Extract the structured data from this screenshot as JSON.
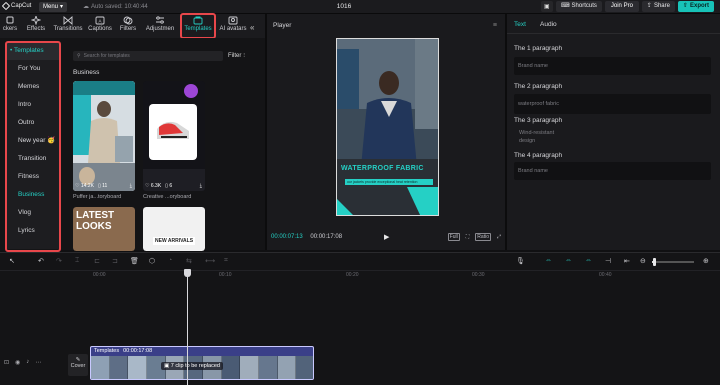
{
  "topbar": {
    "logo": "CapCut",
    "menu_label": "Menu",
    "autosave": "Auto saved: 10:40:44",
    "project_title": "1016",
    "shortcuts_label": "Shortcuts",
    "join_pro_label": "Join Pro",
    "share_label": "Share",
    "export_label": "Export"
  },
  "tool_tabs": [
    {
      "label": "ckers",
      "icon": "sticker-icon"
    },
    {
      "label": "Effects",
      "icon": "effects-icon"
    },
    {
      "label": "Transitions",
      "icon": "transitions-icon"
    },
    {
      "label": "Captions",
      "icon": "captions-icon"
    },
    {
      "label": "Filters",
      "icon": "filters-icon"
    },
    {
      "label": "Adjustmen",
      "icon": "adjustment-icon"
    },
    {
      "label": "Templates",
      "icon": "templates-icon"
    },
    {
      "label": "AI avatars",
      "icon": "ai-avatar-icon"
    }
  ],
  "categories": [
    {
      "label": "• Templates"
    },
    {
      "label": "For You"
    },
    {
      "label": "Memes"
    },
    {
      "label": "Intro"
    },
    {
      "label": "Outro"
    },
    {
      "label": "New year 🥳"
    },
    {
      "label": "Transition"
    },
    {
      "label": "Fitness"
    },
    {
      "label": "Business"
    },
    {
      "label": "Vlog"
    },
    {
      "label": "Lyrics"
    }
  ],
  "search": {
    "placeholder": "Search for templates",
    "filter_label": "Filter"
  },
  "section_label": "Business",
  "cards": [
    {
      "title": "Puffer ja...toryboard",
      "likes": "14.2K",
      "count": "11"
    },
    {
      "title": "Creative ...oryboard",
      "likes": "6.3K",
      "count": "6"
    },
    {
      "title": "",
      "overlay": "LATEST LOOKS"
    },
    {
      "title": "",
      "overlay": "NEW ARRIVALS"
    }
  ],
  "player": {
    "title": "Player",
    "current_time": "00:00:07:13",
    "total_time": "00:00:17:08",
    "video_headline": "WATERPROOF FABRIC",
    "video_sub": "our jackets provide exceptional heat retention",
    "full_label": "Full",
    "ratio_label": "Ratio"
  },
  "text_panel": {
    "tab_text": "Text",
    "tab_audio": "Audio",
    "paragraphs": [
      {
        "label": "The 1 paragraph",
        "value": "Brand name"
      },
      {
        "label": "The 2 paragraph",
        "value": "waterproof fabric"
      },
      {
        "label": "The 3 paragraph",
        "value": "Wind-resistant design"
      },
      {
        "label": "The 4 paragraph",
        "value": "Brand name"
      }
    ]
  },
  "timeline": {
    "ticks": [
      "00:00",
      "00:10",
      "00:20",
      "00:30",
      "00:40"
    ],
    "cover_label": "Cover",
    "clip_name": "Templates",
    "clip_duration": "00:00:17:08",
    "clip_note": "7 clip to be replaced"
  },
  "colors": {
    "accent": "#25d0c5",
    "highlight": "#e8474b",
    "clip": "#3a3f88",
    "export": "#18c3b8"
  }
}
